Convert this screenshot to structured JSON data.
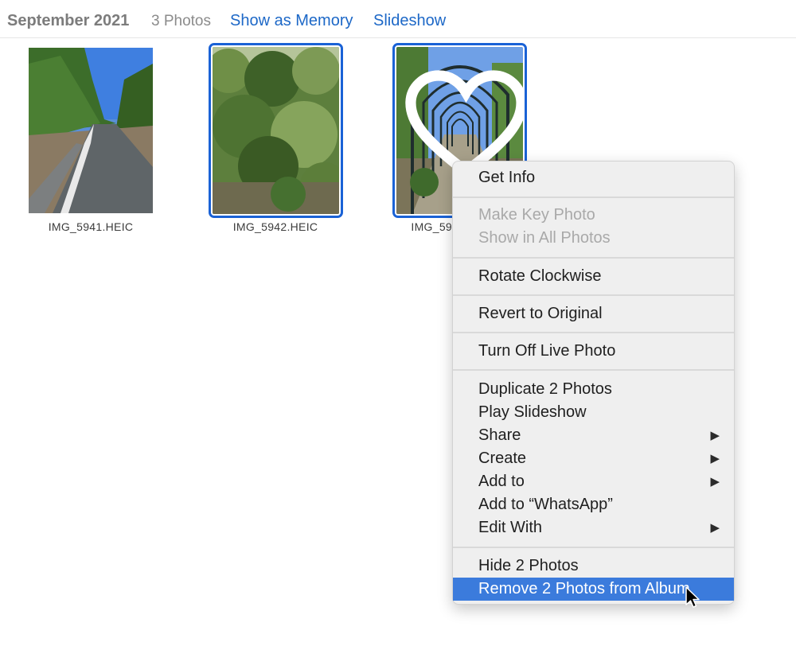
{
  "header": {
    "date": "September 2021",
    "count": "3 Photos",
    "memory_link": "Show as Memory",
    "slideshow_link": "Slideshow"
  },
  "photos": [
    {
      "filename": "IMG_5941.HEIC",
      "selected": false
    },
    {
      "filename": "IMG_5942.HEIC",
      "selected": true
    },
    {
      "filename": "IMG_59",
      "selected": true
    }
  ],
  "context_menu": {
    "get_info": "Get Info",
    "make_key_photo": "Make Key Photo",
    "show_in_all_photos": "Show in All Photos",
    "rotate_clockwise": "Rotate Clockwise",
    "revert_to_original": "Revert to Original",
    "turn_off_live_photo": "Turn Off Live Photo",
    "duplicate": "Duplicate 2 Photos",
    "play_slideshow": "Play Slideshow",
    "share": "Share",
    "create": "Create",
    "add_to": "Add to",
    "add_to_whatsapp": "Add to “WhatsApp”",
    "edit_with": "Edit With",
    "hide": "Hide 2 Photos",
    "remove_from_album": "Remove 2 Photos from Album"
  },
  "colors": {
    "accent": "#1a62d6",
    "link": "#1d68c7",
    "menu_highlight": "#3b7bdc"
  },
  "icons": [
    "heart-icon",
    "submenu-arrow-icon",
    "mouse-pointer-icon"
  ]
}
